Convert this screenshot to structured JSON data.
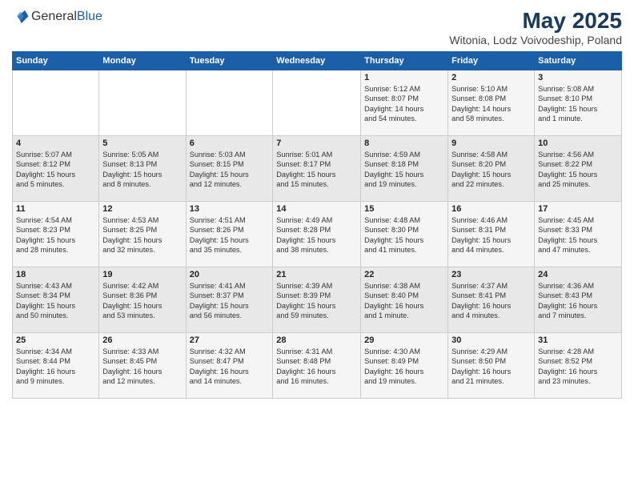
{
  "header": {
    "logo_general": "General",
    "logo_blue": "Blue",
    "main_title": "May 2025",
    "subtitle": "Witonia, Lodz Voivodeship, Poland"
  },
  "days_of_week": [
    "Sunday",
    "Monday",
    "Tuesday",
    "Wednesday",
    "Thursday",
    "Friday",
    "Saturday"
  ],
  "weeks": [
    [
      {
        "day": "",
        "info": ""
      },
      {
        "day": "",
        "info": ""
      },
      {
        "day": "",
        "info": ""
      },
      {
        "day": "",
        "info": ""
      },
      {
        "day": "1",
        "info": "Sunrise: 5:12 AM\nSunset: 8:07 PM\nDaylight: 14 hours\nand 54 minutes."
      },
      {
        "day": "2",
        "info": "Sunrise: 5:10 AM\nSunset: 8:08 PM\nDaylight: 14 hours\nand 58 minutes."
      },
      {
        "day": "3",
        "info": "Sunrise: 5:08 AM\nSunset: 8:10 PM\nDaylight: 15 hours\nand 1 minute."
      }
    ],
    [
      {
        "day": "4",
        "info": "Sunrise: 5:07 AM\nSunset: 8:12 PM\nDaylight: 15 hours\nand 5 minutes."
      },
      {
        "day": "5",
        "info": "Sunrise: 5:05 AM\nSunset: 8:13 PM\nDaylight: 15 hours\nand 8 minutes."
      },
      {
        "day": "6",
        "info": "Sunrise: 5:03 AM\nSunset: 8:15 PM\nDaylight: 15 hours\nand 12 minutes."
      },
      {
        "day": "7",
        "info": "Sunrise: 5:01 AM\nSunset: 8:17 PM\nDaylight: 15 hours\nand 15 minutes."
      },
      {
        "day": "8",
        "info": "Sunrise: 4:59 AM\nSunset: 8:18 PM\nDaylight: 15 hours\nand 19 minutes."
      },
      {
        "day": "9",
        "info": "Sunrise: 4:58 AM\nSunset: 8:20 PM\nDaylight: 15 hours\nand 22 minutes."
      },
      {
        "day": "10",
        "info": "Sunrise: 4:56 AM\nSunset: 8:22 PM\nDaylight: 15 hours\nand 25 minutes."
      }
    ],
    [
      {
        "day": "11",
        "info": "Sunrise: 4:54 AM\nSunset: 8:23 PM\nDaylight: 15 hours\nand 28 minutes."
      },
      {
        "day": "12",
        "info": "Sunrise: 4:53 AM\nSunset: 8:25 PM\nDaylight: 15 hours\nand 32 minutes."
      },
      {
        "day": "13",
        "info": "Sunrise: 4:51 AM\nSunset: 8:26 PM\nDaylight: 15 hours\nand 35 minutes."
      },
      {
        "day": "14",
        "info": "Sunrise: 4:49 AM\nSunset: 8:28 PM\nDaylight: 15 hours\nand 38 minutes."
      },
      {
        "day": "15",
        "info": "Sunrise: 4:48 AM\nSunset: 8:30 PM\nDaylight: 15 hours\nand 41 minutes."
      },
      {
        "day": "16",
        "info": "Sunrise: 4:46 AM\nSunset: 8:31 PM\nDaylight: 15 hours\nand 44 minutes."
      },
      {
        "day": "17",
        "info": "Sunrise: 4:45 AM\nSunset: 8:33 PM\nDaylight: 15 hours\nand 47 minutes."
      }
    ],
    [
      {
        "day": "18",
        "info": "Sunrise: 4:43 AM\nSunset: 8:34 PM\nDaylight: 15 hours\nand 50 minutes."
      },
      {
        "day": "19",
        "info": "Sunrise: 4:42 AM\nSunset: 8:36 PM\nDaylight: 15 hours\nand 53 minutes."
      },
      {
        "day": "20",
        "info": "Sunrise: 4:41 AM\nSunset: 8:37 PM\nDaylight: 15 hours\nand 56 minutes."
      },
      {
        "day": "21",
        "info": "Sunrise: 4:39 AM\nSunset: 8:39 PM\nDaylight: 15 hours\nand 59 minutes."
      },
      {
        "day": "22",
        "info": "Sunrise: 4:38 AM\nSunset: 8:40 PM\nDaylight: 16 hours\nand 1 minute."
      },
      {
        "day": "23",
        "info": "Sunrise: 4:37 AM\nSunset: 8:41 PM\nDaylight: 16 hours\nand 4 minutes."
      },
      {
        "day": "24",
        "info": "Sunrise: 4:36 AM\nSunset: 8:43 PM\nDaylight: 16 hours\nand 7 minutes."
      }
    ],
    [
      {
        "day": "25",
        "info": "Sunrise: 4:34 AM\nSunset: 8:44 PM\nDaylight: 16 hours\nand 9 minutes."
      },
      {
        "day": "26",
        "info": "Sunrise: 4:33 AM\nSunset: 8:45 PM\nDaylight: 16 hours\nand 12 minutes."
      },
      {
        "day": "27",
        "info": "Sunrise: 4:32 AM\nSunset: 8:47 PM\nDaylight: 16 hours\nand 14 minutes."
      },
      {
        "day": "28",
        "info": "Sunrise: 4:31 AM\nSunset: 8:48 PM\nDaylight: 16 hours\nand 16 minutes."
      },
      {
        "day": "29",
        "info": "Sunrise: 4:30 AM\nSunset: 8:49 PM\nDaylight: 16 hours\nand 19 minutes."
      },
      {
        "day": "30",
        "info": "Sunrise: 4:29 AM\nSunset: 8:50 PM\nDaylight: 16 hours\nand 21 minutes."
      },
      {
        "day": "31",
        "info": "Sunrise: 4:28 AM\nSunset: 8:52 PM\nDaylight: 16 hours\nand 23 minutes."
      }
    ]
  ]
}
